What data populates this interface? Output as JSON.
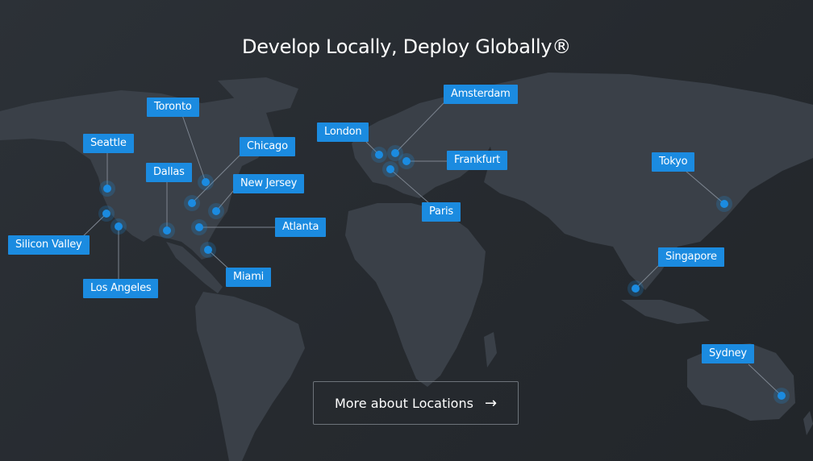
{
  "page": {
    "title": "Develop Locally, Deploy Globally®"
  },
  "locations": [
    {
      "id": "toronto",
      "label": "Toronto"
    },
    {
      "id": "seattle",
      "label": "Seattle"
    },
    {
      "id": "chicago",
      "label": "Chicago"
    },
    {
      "id": "dallas",
      "label": "Dallas"
    },
    {
      "id": "new-jersey",
      "label": "New Jersey"
    },
    {
      "id": "atlanta",
      "label": "Atlanta"
    },
    {
      "id": "silicon-valley",
      "label": "Silicon Valley"
    },
    {
      "id": "los-angeles",
      "label": "Los Angeles"
    },
    {
      "id": "miami",
      "label": "Miami"
    },
    {
      "id": "london",
      "label": "London"
    },
    {
      "id": "amsterdam",
      "label": "Amsterdam"
    },
    {
      "id": "frankfurt",
      "label": "Frankfurt"
    },
    {
      "id": "paris",
      "label": "Paris"
    },
    {
      "id": "tokyo",
      "label": "Tokyo"
    },
    {
      "id": "singapore",
      "label": "Singapore"
    },
    {
      "id": "sydney",
      "label": "Sydney"
    }
  ],
  "cta": {
    "label": "More about Locations",
    "arrow": "→"
  },
  "colors": {
    "accent": "#1b8be0",
    "background": "#2a2f35",
    "land": "#3a4048"
  }
}
